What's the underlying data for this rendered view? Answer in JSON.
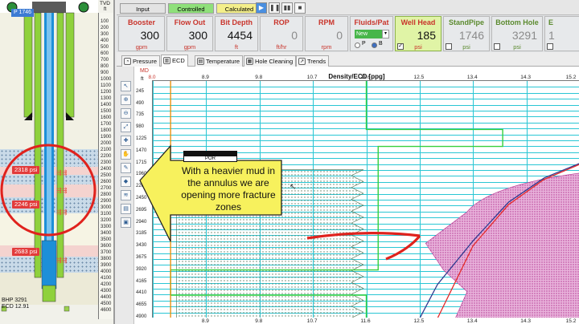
{
  "well": {
    "top_label": "P 1746",
    "tvd_label": "TVD",
    "tvd_unit": "ft",
    "depth_ticks": [
      "100",
      "200",
      "300",
      "400",
      "500",
      "600",
      "700",
      "800",
      "900",
      "1000",
      "1100",
      "1200",
      "1300",
      "1400",
      "1500",
      "1600",
      "1700",
      "1800",
      "1900",
      "2000",
      "2100",
      "2200",
      "2300",
      "2400",
      "2500",
      "2600",
      "2700",
      "2800",
      "2900",
      "3000",
      "3100",
      "3200",
      "3300",
      "3400",
      "3500",
      "3600",
      "3700",
      "3800",
      "3900",
      "4000",
      "4100",
      "4200",
      "4300",
      "4400",
      "4500",
      "4600"
    ],
    "psi_labels": [
      "2318 psi",
      "2246 psi",
      "2683 psi"
    ],
    "bhp_label": "BHP 3291",
    "ecd_label": "ECD 12.91"
  },
  "toolbar": {
    "input": "Input",
    "controlled": "Controlled",
    "calculated": "Calculated"
  },
  "params": [
    {
      "label": "Booster",
      "value": "300",
      "unit": "gpm"
    },
    {
      "label": "Flow Out",
      "value": "300",
      "unit": "gpm"
    },
    {
      "label": "Bit Depth",
      "value": "4454",
      "unit": "ft"
    },
    {
      "label": "ROP",
      "value": "0",
      "unit": "ft/hr"
    },
    {
      "label": "RPM",
      "value": "0",
      "unit": "rpm"
    }
  ],
  "fluids": {
    "label": "Fluids/Pat",
    "select": "New",
    "p": "P",
    "b": "B"
  },
  "pressures": [
    {
      "label": "Well Head",
      "value": "185",
      "unit": "psi"
    },
    {
      "label": "StandPipe",
      "value": "1746",
      "unit": "psi"
    },
    {
      "label": "Bottom Hole",
      "value": "3291",
      "unit": "psi"
    },
    {
      "label": "E",
      "value": "1",
      "unit": ""
    }
  ],
  "tabs": [
    "Pressure",
    "ECD",
    "Temperature",
    "Hole Cleaning",
    "Trends"
  ],
  "active_tab": "ECD",
  "chart_data": {
    "type": "line",
    "title": "Density/ECD [ppg]",
    "ylabel": "MD",
    "yunit": "ft",
    "xlim": [
      8.0,
      15.2
    ],
    "xticks": [
      "8.0",
      "8.9",
      "9.8",
      "10.7",
      "11.6",
      "12.5",
      "13.4",
      "14.3",
      "15.2"
    ],
    "xticks_bottom": [
      "8.9",
      "9.8",
      "10.7",
      "11.6",
      "12.5",
      "13.4",
      "14.3",
      "15.2"
    ],
    "yticks": [
      "245",
      "490",
      "735",
      "980",
      "1225",
      "1470",
      "1715",
      "1960",
      "2205",
      "2450",
      "2695",
      "2940",
      "3185",
      "3430",
      "3675",
      "3920",
      "4165",
      "4410",
      "4655",
      "4900"
    ],
    "series": [
      {
        "name": "",
        "color": "#e68a00",
        "x": [
          8.3,
          8.3
        ],
        "y": [
          0,
          4900
        ]
      },
      {
        "name": "",
        "color": "#2e3a8f",
        "x": [
          12.5,
          12.8,
          13.4,
          14.0,
          14.6,
          15.2
        ],
        "y": [
          4900,
          4200,
          3300,
          2500,
          2000,
          1700
        ]
      },
      {
        "name": "",
        "color": "#e32b2b",
        "x": [
          12.8,
          13.0,
          13.4,
          14.0,
          14.6,
          15.2
        ],
        "y": [
          4900,
          4400,
          3400,
          2550,
          2030,
          1720
        ]
      }
    ],
    "grid": true
  },
  "callout": {
    "text": "With a heavier mud in the annulus we are opening more fracture zones",
    "box_label": "POR"
  }
}
